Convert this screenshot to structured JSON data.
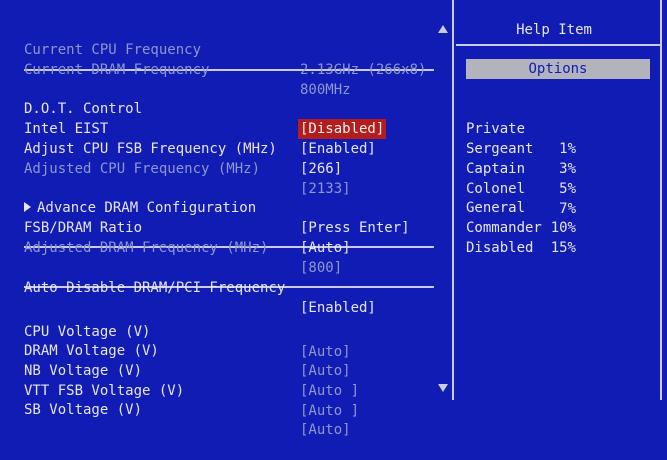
{
  "freq": {
    "cpu_label": "Current CPU Frequency",
    "cpu_value": "2.13GHz (266x8)",
    "dram_label": "Current DRAM Frequency",
    "dram_value": "800MHz"
  },
  "settings": [
    {
      "label": "D.O.T. Control",
      "value": "[Disabled]"
    },
    {
      "label": "Intel EIST",
      "value": "[Enabled]"
    },
    {
      "label": "Adjust CPU FSB Frequency (MHz)",
      "value": "[266]"
    },
    {
      "label": "Adjusted CPU Frequency (MHz)",
      "value": "[2133]"
    },
    {
      "label": "Advance DRAM Configuration",
      "value": "[Press Enter]"
    },
    {
      "label": "FSB/DRAM Ratio",
      "value": "[Auto]"
    },
    {
      "label": "Adjusted DRAM Frequency (MHz)",
      "value": "[800]"
    },
    {
      "label": "Auto Disable DRAM/PCI Frequency",
      "value": "[Enabled]"
    },
    {
      "label": "CPU Voltage (V)",
      "value": "[Auto]"
    },
    {
      "label": "DRAM Voltage (V)",
      "value": "[Auto]"
    },
    {
      "label": "NB Voltage (V)",
      "value": "[Auto ]"
    },
    {
      "label": "VTT FSB Voltage (V)",
      "value": "[Auto ]"
    },
    {
      "label": "SB Voltage (V)",
      "value": "[Auto]"
    }
  ],
  "help": {
    "title": "Help Item",
    "options_label": "Options",
    "ranks": [
      {
        "name": "Private",
        "pct": "1%"
      },
      {
        "name": "Sergeant",
        "pct": "3%"
      },
      {
        "name": "Captain",
        "pct": "5%"
      },
      {
        "name": "Colonel",
        "pct": "7%"
      },
      {
        "name": "General",
        "pct": "10%"
      },
      {
        "name": "Commander",
        "pct": "15%"
      }
    ],
    "disabled_label": "Disabled"
  },
  "colors": {
    "background": "#101cb4",
    "highlight": "#b51c1c",
    "options_box": "#b3b3bd",
    "dim_text": "#8e97cf"
  }
}
